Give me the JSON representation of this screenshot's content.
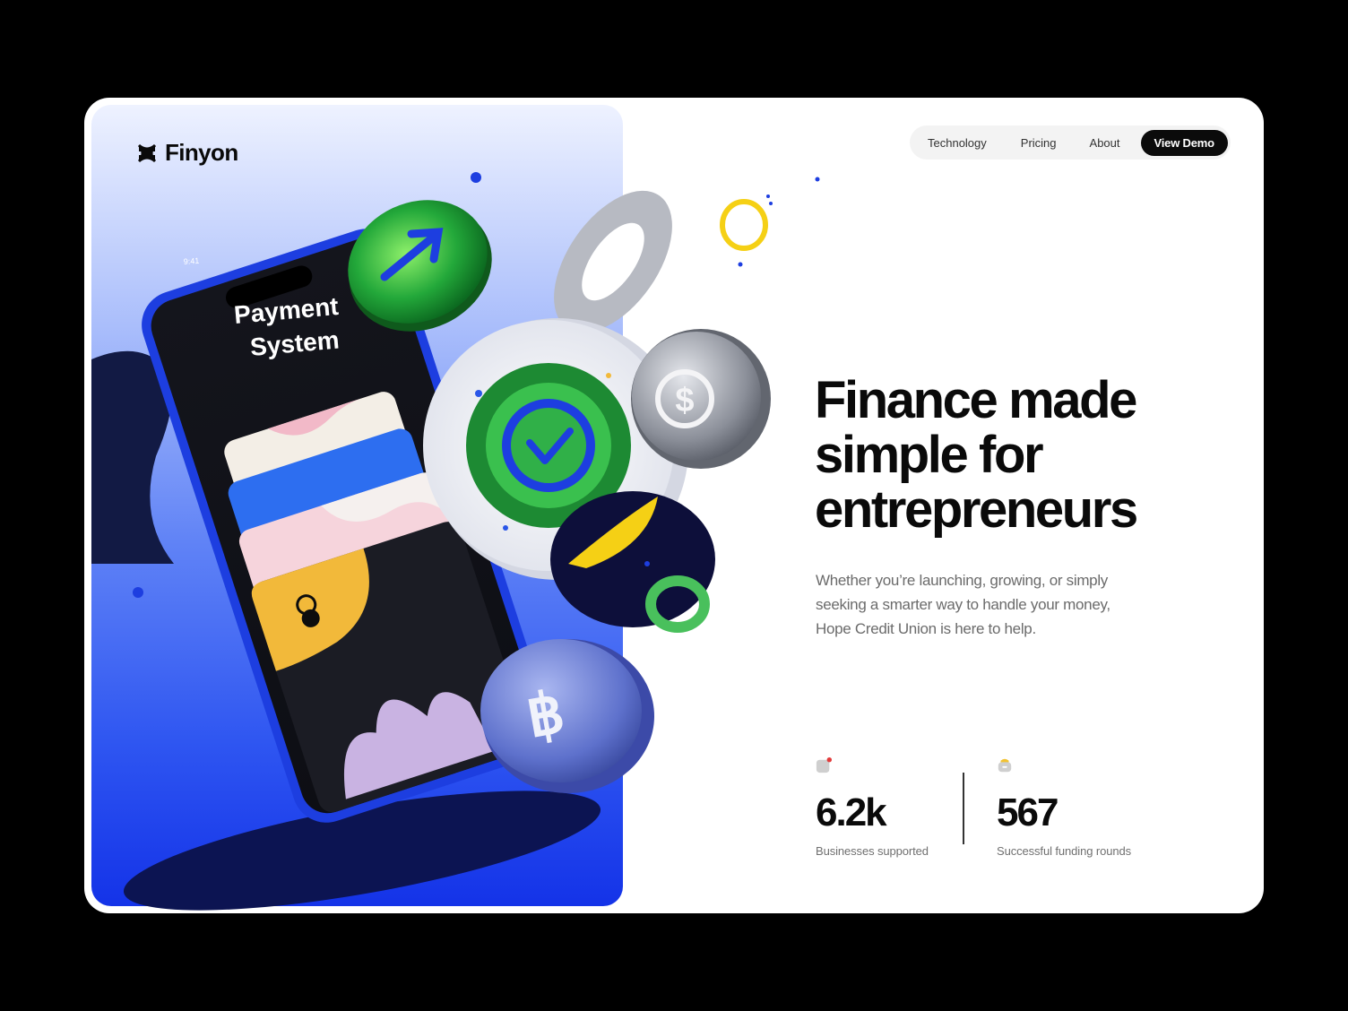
{
  "brand": {
    "name": "Finyon",
    "icon": "x-cross-icon"
  },
  "nav": {
    "items": [
      "Technology",
      "Pricing",
      "About"
    ],
    "cta": "View Demo"
  },
  "hero": {
    "headline": "Finance made simple for entrepreneurs",
    "subtext": "Whether you’re launching, growing, or simply seeking a smarter way to handle your money, Hope Credit Union is here to help."
  },
  "phone": {
    "time": "9:41",
    "title_line1": "Payment",
    "title_line2": "System"
  },
  "stats": [
    {
      "value": "6.2k",
      "label": "Businesses supported",
      "icon": "app-badge-icon"
    },
    {
      "value": "567",
      "label": "Successful funding rounds",
      "icon": "wallet-icon"
    }
  ],
  "colors": {
    "accent_blue": "#1d3df0",
    "dark": "#0a0a0a",
    "green": "#35b34a",
    "yellow": "#f2c230"
  }
}
